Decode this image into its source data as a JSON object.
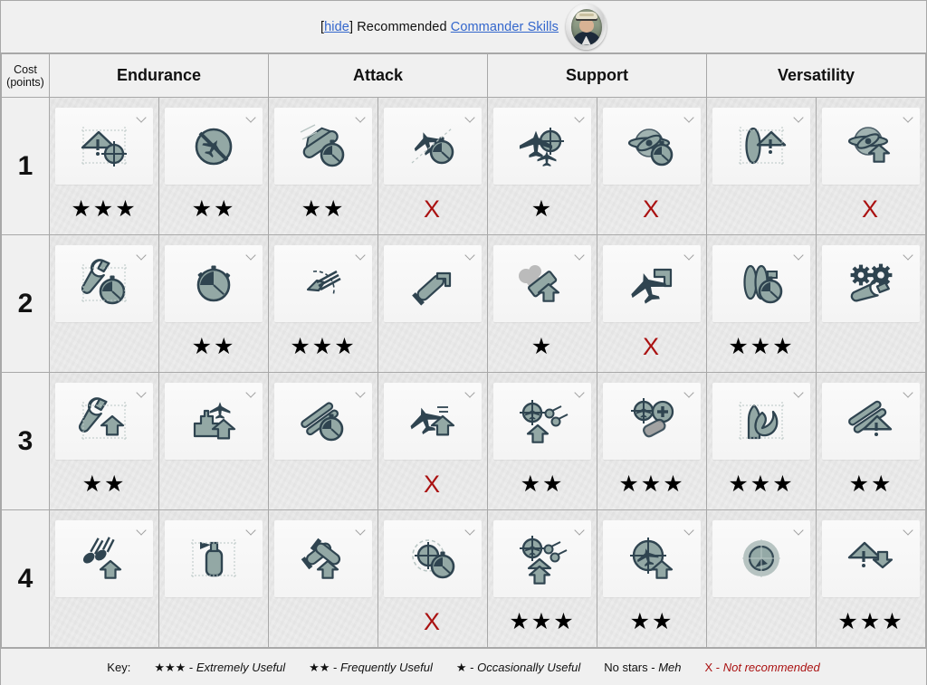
{
  "header": {
    "hide_open_bracket": "[",
    "hide_label": "hide",
    "hide_close_bracket": "] ",
    "recommended_label": "Recommended ",
    "subject_link": "Commander Skills",
    "avatar_name": "commander-portrait"
  },
  "table": {
    "cost_header_line1": "Cost",
    "cost_header_line2": "(points)",
    "columns": [
      "Endurance",
      "Attack",
      "Support",
      "Versatility"
    ],
    "rows": [
      {
        "cost": "1",
        "cells": [
          {
            "icon": "warning-triangle-target-icon",
            "rating": "★★★",
            "rating_type": "stars"
          },
          {
            "icon": "no-aircraft-circle-icon",
            "rating": "★★",
            "rating_type": "stars"
          },
          {
            "icon": "ship-speed-stopwatch-icon",
            "rating": "★★",
            "rating_type": "stars"
          },
          {
            "icon": "aircraft-stopwatch-icon",
            "rating": "X",
            "rating_type": "not-recommended"
          },
          {
            "icon": "two-aircraft-target-icon",
            "rating": "★",
            "rating_type": "stars"
          },
          {
            "icon": "propeller-stopwatch-icon",
            "rating": "X",
            "rating_type": "not-recommended"
          },
          {
            "icon": "torpedo-warning-icon",
            "rating": "",
            "rating_type": "none"
          },
          {
            "icon": "propeller-up-arrow-icon",
            "rating": "X",
            "rating_type": "not-recommended"
          }
        ]
      },
      {
        "cost": "2",
        "cells": [
          {
            "icon": "wrench-stopwatch-icon",
            "rating": "",
            "rating_type": "none"
          },
          {
            "icon": "stopwatch-icon",
            "rating": "★★",
            "rating_type": "stars"
          },
          {
            "icon": "secondary-guns-arc-icon",
            "rating": "★★★",
            "rating_type": "stars"
          },
          {
            "icon": "torpedo-up-arrow-icon",
            "rating": "",
            "rating_type": "none"
          },
          {
            "icon": "smoke-up-arrow-icon",
            "rating": "★",
            "rating_type": "stars"
          },
          {
            "icon": "aircraft-up-arrow-icon",
            "rating": "X",
            "rating_type": "not-recommended"
          },
          {
            "icon": "torpedo-tubes-stopwatch-icon",
            "rating": "★★★",
            "rating_type": "stars"
          },
          {
            "icon": "gears-wrench-icon",
            "rating": "",
            "rating_type": "none"
          }
        ]
      },
      {
        "cost": "3",
        "cells": [
          {
            "icon": "wrench-up-arrow-icon",
            "rating": "★★",
            "rating_type": "stars"
          },
          {
            "icon": "carrier-aircraft-up-arrow-icon",
            "rating": "",
            "rating_type": "none"
          },
          {
            "icon": "main-guns-stopwatch-icon",
            "rating": "",
            "rating_type": "none"
          },
          {
            "icon": "aircraft-up-arrow-list-icon",
            "rating": "X",
            "rating_type": "not-recommended"
          },
          {
            "icon": "aa-target-burst-up-arrow-icon",
            "rating": "★★",
            "rating_type": "stars"
          },
          {
            "icon": "aa-target-plus-tank-icon",
            "rating": "★★★",
            "rating_type": "stars"
          },
          {
            "icon": "shell-fire-icon",
            "rating": "★★★",
            "rating_type": "stars"
          },
          {
            "icon": "main-guns-warning-icon",
            "rating": "★★",
            "rating_type": "stars"
          }
        ]
      },
      {
        "cost": "4",
        "cells": [
          {
            "icon": "shells-burst-up-arrow-icon",
            "rating": "",
            "rating_type": "none"
          },
          {
            "icon": "smoke-generator-icon",
            "rating": "",
            "rating_type": "none"
          },
          {
            "icon": "crossed-torpedoes-up-arrow-icon",
            "rating": "",
            "rating_type": "none"
          },
          {
            "icon": "radar-target-stopwatch-icon",
            "rating": "X",
            "rating_type": "not-recommended"
          },
          {
            "icon": "aa-burst-double-arrow-icon",
            "rating": "★★★",
            "rating_type": "stars"
          },
          {
            "icon": "aircraft-crosshair-up-arrow-icon",
            "rating": "★★",
            "rating_type": "stars"
          },
          {
            "icon": "sonar-radar-sweep-icon",
            "rating": "",
            "rating_type": "none"
          },
          {
            "icon": "warning-down-arrow-icon",
            "rating": "★★★",
            "rating_type": "stars"
          }
        ]
      }
    ]
  },
  "key": {
    "lead": "Key:",
    "items": [
      {
        "symbol": "★★★",
        "dash": " - ",
        "desc": "Extremely Useful",
        "bad": false
      },
      {
        "symbol": "★★",
        "dash": " - ",
        "desc": "Frequently Useful",
        "bad": false
      },
      {
        "symbol": "★",
        "dash": " - ",
        "desc": "Occasionally Useful",
        "bad": false
      },
      {
        "symbol": "No stars",
        "dash": " - ",
        "desc": "Meh",
        "bad": false
      },
      {
        "symbol": "X",
        "dash": " - ",
        "desc": "Not recommended",
        "bad": true
      }
    ]
  },
  "colors": {
    "link": "#3366cc",
    "not_recommended": "#aa1111",
    "icon_dark": "#2f4450",
    "icon_fill": "#93a8a5",
    "page_bg": "#f0f0f0",
    "border": "#a8a8a8"
  }
}
